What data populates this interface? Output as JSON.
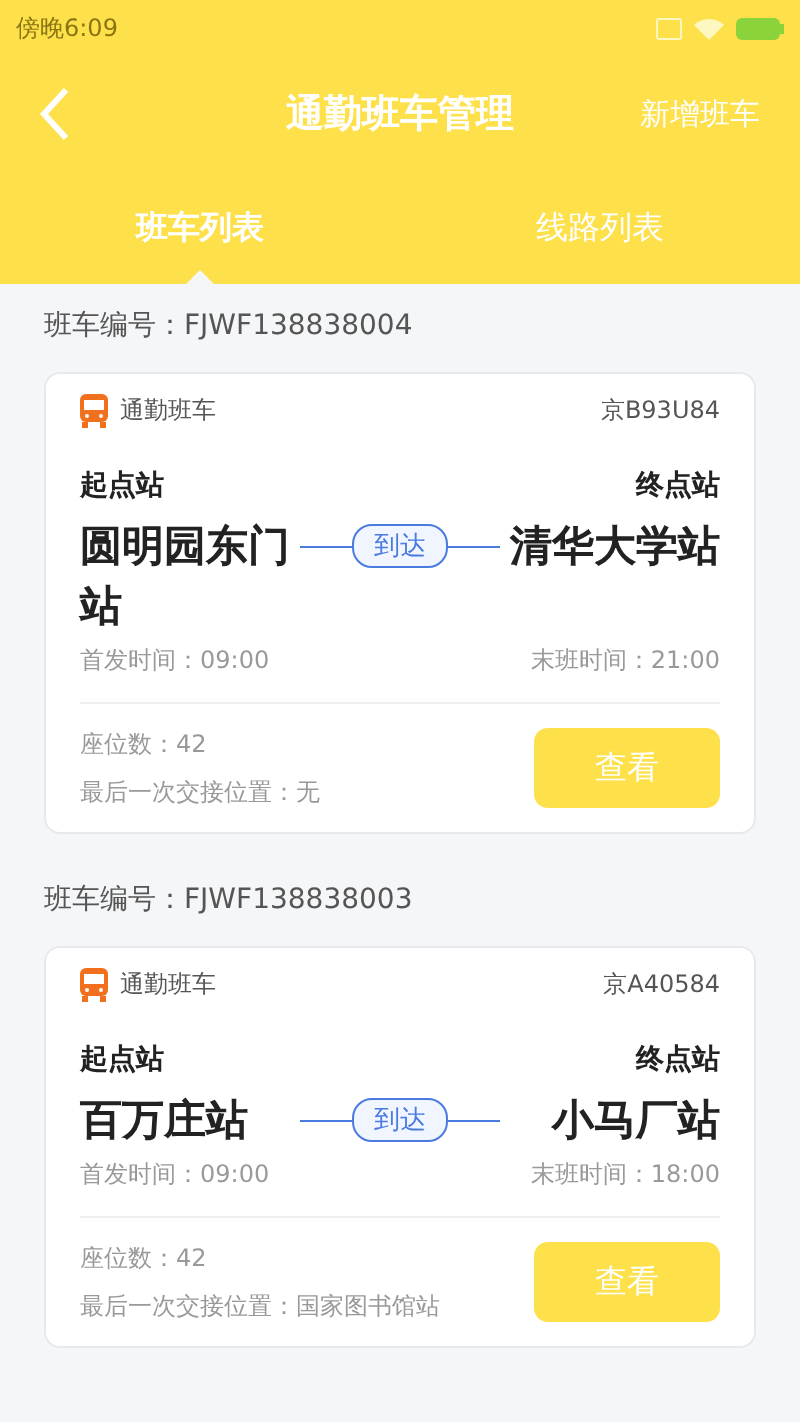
{
  "status_bar": {
    "time": "傍晚6:09"
  },
  "header": {
    "title": "通勤班车管理",
    "action": "新增班车"
  },
  "tabs": [
    {
      "label": "班车列表",
      "selected": true
    },
    {
      "label": "线路列表",
      "selected": false
    }
  ],
  "buses": [
    {
      "number_label": "班车编号：FJWF138838004",
      "type": "通勤班车",
      "plate": "京B93U84",
      "start_label": "起点站",
      "end_label": "终点站",
      "start": "圆明园东门站",
      "end": "清华大学站",
      "arrive": "到达",
      "first_time": "首发时间：09:00",
      "last_time": "末班时间：21:00",
      "seats": "座位数：42",
      "last_handover": "最后一次交接位置：无",
      "button": "查看"
    },
    {
      "number_label": "班车编号：FJWF138838003",
      "type": "通勤班车",
      "plate": "京A40584",
      "start_label": "起点站",
      "end_label": "终点站",
      "start": "百万庄站",
      "end": "小马厂站",
      "arrive": "到达",
      "first_time": "首发时间：09:00",
      "last_time": "末班时间：18:00",
      "seats": "座位数：42",
      "last_handover": "最后一次交接位置：国家图书馆站",
      "button": "查看"
    }
  ]
}
